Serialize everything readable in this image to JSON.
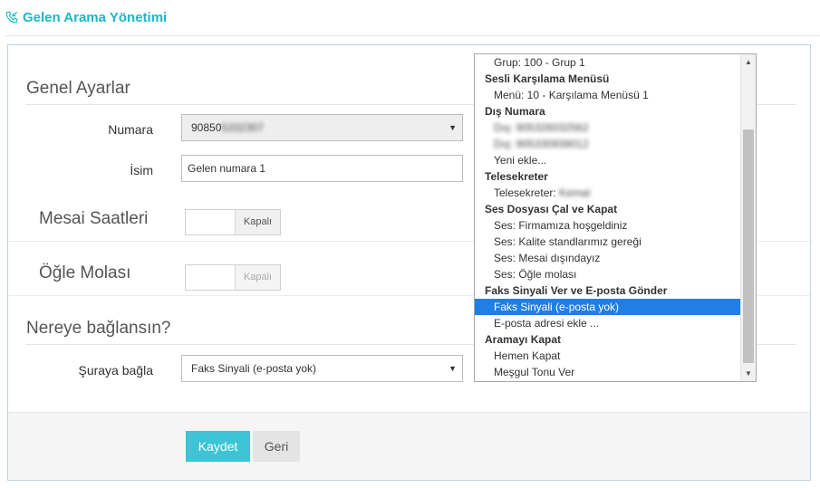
{
  "header": {
    "title": "Gelen Arama Yönetimi"
  },
  "general": {
    "title": "Genel Ayarlar",
    "number_label": "Numara",
    "number_prefix": "90850",
    "number_masked": "5332307",
    "name_label": "İsim",
    "name_value": "Gelen numara 1"
  },
  "office_hours": {
    "label": "Mesai Saatleri",
    "state": "Kapalı"
  },
  "lunch_break": {
    "label": "Öğle Molası",
    "state": "Kapalı"
  },
  "routing": {
    "title": "Nereye bağlansın?",
    "connect_label": "Şuraya bağla",
    "connect_value": "Faks Sinyali (e-posta yok)"
  },
  "dropdown": {
    "items": [
      {
        "kind": "option",
        "label": "Grup: 100 - Grup 1"
      },
      {
        "kind": "group",
        "label": "Sesli Karşılama Menüsü"
      },
      {
        "kind": "option",
        "label": "Menü: 10 - Karşılama Menüsü 1"
      },
      {
        "kind": "group",
        "label": "Dış Numara"
      },
      {
        "kind": "option-blur",
        "label": "Dış: 905326032562"
      },
      {
        "kind": "option-blur",
        "label": "Dış: 905330939012"
      },
      {
        "kind": "option",
        "label": "Yeni ekle..."
      },
      {
        "kind": "group",
        "label": "Telesekreter"
      },
      {
        "kind": "option-partial",
        "prefix": "Telesekreter: ",
        "label": "Kemal"
      },
      {
        "kind": "group",
        "label": "Ses Dosyası Çal ve Kapat"
      },
      {
        "kind": "option",
        "label": "Ses: Firmamıza hoşgeldiniz"
      },
      {
        "kind": "option",
        "label": "Ses: Kalite standlarımız gereği"
      },
      {
        "kind": "option",
        "label": "Ses: Mesai dışındayız"
      },
      {
        "kind": "option",
        "label": "Ses: Öğle molası"
      },
      {
        "kind": "group",
        "label": "Faks Sinyali Ver ve E-posta Gönder"
      },
      {
        "kind": "option",
        "label": "Faks Sinyali (e-posta yok)",
        "selected": true
      },
      {
        "kind": "option",
        "label": "E-posta adresi ekle ..."
      },
      {
        "kind": "group",
        "label": "Aramayı Kapat"
      },
      {
        "kind": "option",
        "label": "Hemen Kapat"
      },
      {
        "kind": "option",
        "label": "Meşgul Tonu Ver"
      }
    ]
  },
  "footer": {
    "save_label": "Kaydet",
    "back_label": "Geri"
  },
  "colors": {
    "accent": "#1cb7c7",
    "save_button": "#3cc4d4",
    "selection": "#1e7fe6"
  },
  "icons": {
    "header_icon": "phone-incoming-icon"
  }
}
